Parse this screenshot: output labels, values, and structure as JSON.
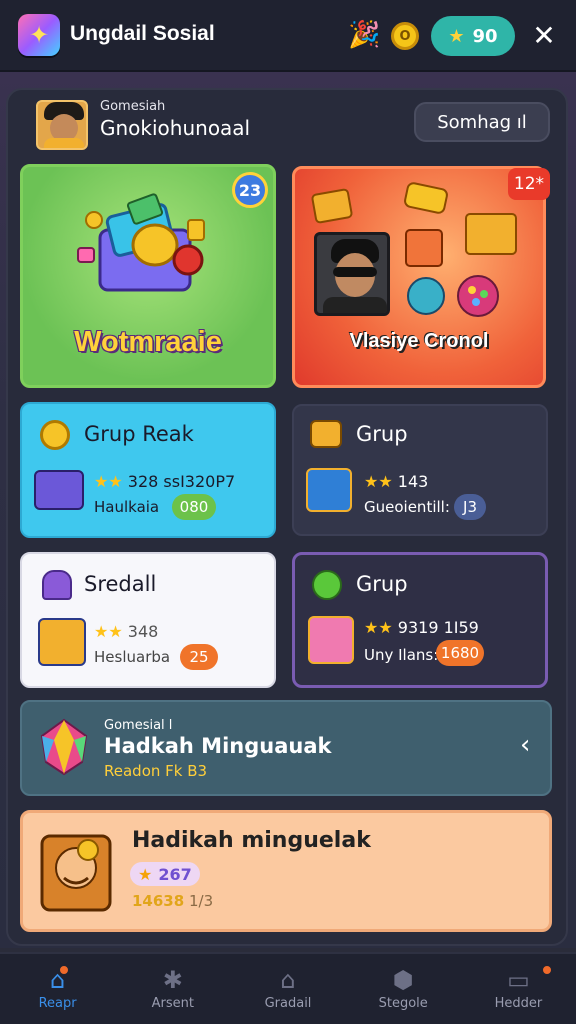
{
  "app": {
    "title": "Ungdail Sosial",
    "star_count": "90",
    "coin_glyph": "O"
  },
  "profile": {
    "subtitle": "Gomesiah",
    "name": "Gnokiohunoaal",
    "search_button": "Somhag ıl"
  },
  "featured": {
    "left": {
      "label": "Wotmraaie",
      "badge": "23"
    },
    "right": {
      "label": "Vlasiye Cronol",
      "badge": "12*"
    }
  },
  "cards": [
    {
      "title": "Grup Reak",
      "stars_text": "328 ssI320P7",
      "sub": "Haulkaia",
      "pill": "080"
    },
    {
      "title": "Grup",
      "stars_text": "143",
      "sub": "Gueoientill:",
      "pill": "J3"
    },
    {
      "title": "Sredall",
      "stars_text": "348",
      "sub": "Hesluarba",
      "pill": "25"
    },
    {
      "title": "Grup",
      "stars_text": "9319 1I59",
      "sub": "Uny Ilans:",
      "pill": "1680"
    }
  ],
  "banner1": {
    "subtitle": "Gomesial l",
    "title": "Hadkah Minguauak",
    "reward": "Readon Fk B3"
  },
  "banner2": {
    "title": "Hadikah minguelak",
    "pill": "267",
    "meta_highlight": "14638",
    "meta_rest": "1/3"
  },
  "nav": [
    {
      "label": "Reapr",
      "icon": "home-icon"
    },
    {
      "label": "Arsent",
      "icon": "gear-icon"
    },
    {
      "label": "Gradail",
      "icon": "bell-icon"
    },
    {
      "label": "Stegole",
      "icon": "shield-icon"
    },
    {
      "label": "Hedder",
      "icon": "inbox-icon"
    }
  ],
  "colors": {
    "accent_teal": "#2fb5a8",
    "card_cyan": "#3fc8ee",
    "nav_active": "#3a8fe8",
    "badge_orange": "#f06a2a"
  }
}
